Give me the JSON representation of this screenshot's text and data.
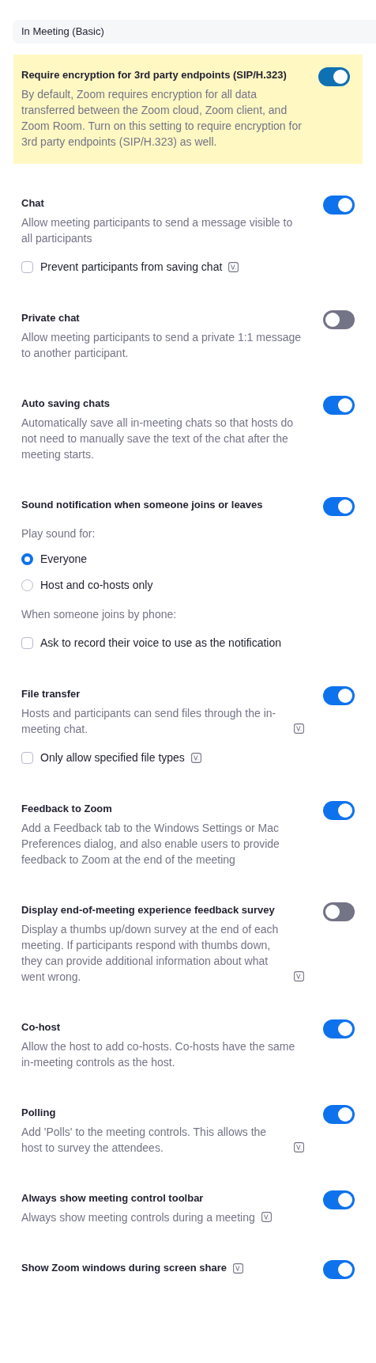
{
  "header": {
    "title": "In Meeting (Basic)"
  },
  "settings": [
    {
      "title": "Require encryption for 3rd party endpoints (SIP/H.323)",
      "title_info": false,
      "description": "By default, Zoom requires encryption for all data transferred between the Zoom cloud, Zoom client, and Zoom Room. Turn on this setting to require encryption for 3rd party endpoints (SIP/H.323) as well.",
      "description_info": false,
      "on": true,
      "highlighted": true
    },
    {
      "title": "Chat",
      "title_info": false,
      "description": "Allow meeting participants to send a message visible to all participants",
      "description_info": false,
      "on": true,
      "highlighted": false,
      "options": [
        {
          "kind": "checkbox",
          "label": "Prevent participants from saving chat",
          "checked": false,
          "info": true
        }
      ]
    },
    {
      "title": "Private chat",
      "title_info": false,
      "description": "Allow meeting participants to send a private 1:1 message to another participant.",
      "description_info": false,
      "on": false,
      "highlighted": false
    },
    {
      "title": "Auto saving chats",
      "title_info": false,
      "description": "Automatically save all in-meeting chats so that hosts do not need to manually save the text of the chat after the meeting starts.",
      "description_info": false,
      "on": true,
      "highlighted": false
    },
    {
      "title": "Sound notification when someone joins or leaves",
      "title_info": false,
      "on": true,
      "highlighted": false,
      "options": [
        {
          "kind": "note",
          "label": "Play sound for:"
        },
        {
          "kind": "radio",
          "label": "Everyone",
          "selected": true
        },
        {
          "kind": "radio",
          "label": "Host and co-hosts only",
          "selected": false
        },
        {
          "kind": "note",
          "label": "When someone joins by phone:"
        },
        {
          "kind": "checkbox",
          "label": "Ask to record their voice to use as the notification",
          "checked": false,
          "info": false
        }
      ]
    },
    {
      "title": "File transfer",
      "title_info": false,
      "description": "Hosts and participants can send files through the in-meeting chat.",
      "description_info": true,
      "on": true,
      "highlighted": false,
      "options": [
        {
          "kind": "checkbox",
          "label": "Only allow specified file types",
          "checked": false,
          "info": true
        }
      ]
    },
    {
      "title": "Feedback to Zoom",
      "title_info": false,
      "description": "Add a Feedback tab to the Windows Settings or Mac Preferences dialog, and also enable users to provide feedback to Zoom at the end of the meeting",
      "description_info": false,
      "on": true,
      "highlighted": false
    },
    {
      "title": "Display end-of-meeting experience feedback survey",
      "title_info": false,
      "description": "Display a thumbs up/down survey at the end of each meeting. If participants respond with thumbs down, they can provide additional information about what went wrong.",
      "description_info": true,
      "on": false,
      "highlighted": false
    },
    {
      "title": "Co-host",
      "title_info": false,
      "description": "Allow the host to add co-hosts. Co-hosts have the same in-meeting controls as the host.",
      "description_info": false,
      "on": true,
      "highlighted": false
    },
    {
      "title": "Polling",
      "title_info": false,
      "description": "Add 'Polls' to the meeting controls. This allows the host to survey the attendees.",
      "description_info": true,
      "on": true,
      "highlighted": false
    },
    {
      "title": "Always show meeting control toolbar",
      "title_info": false,
      "description": "Always show meeting controls during a meeting",
      "description_info": true,
      "on": true,
      "highlighted": false
    },
    {
      "title": "Show Zoom windows during screen share",
      "title_info": true,
      "on": true,
      "highlighted": false
    }
  ]
}
